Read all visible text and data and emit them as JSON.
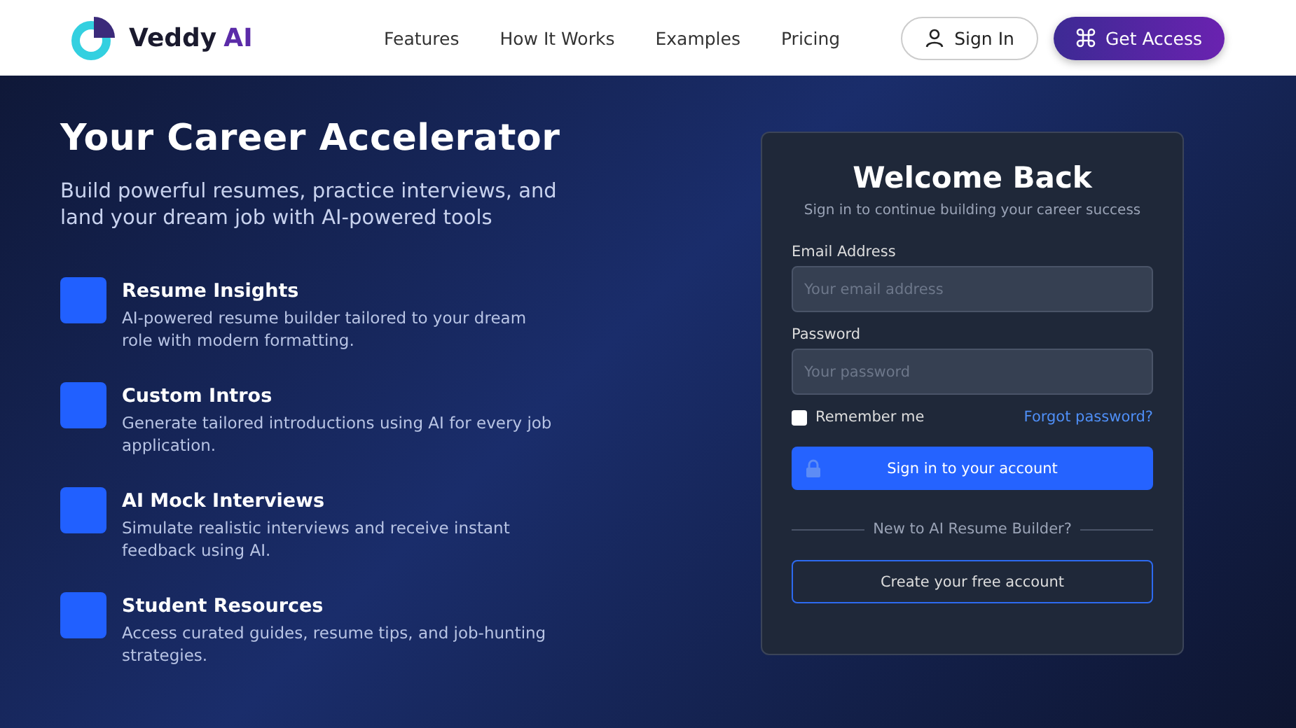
{
  "header": {
    "logo": {
      "name": "Veddy",
      "accent": "AI"
    },
    "nav": [
      {
        "label": "Features"
      },
      {
        "label": "How It Works"
      },
      {
        "label": "Examples"
      },
      {
        "label": "Pricing"
      }
    ],
    "sign_in": "Sign In",
    "get_access": "Get Access"
  },
  "hero": {
    "title": "Your Career Accelerator",
    "subtitle": "Build powerful resumes, practice interviews, and land your dream job with AI-powered tools",
    "features": [
      {
        "title": "Resume Insights",
        "text": "AI-powered resume builder tailored to your dream role with modern formatting."
      },
      {
        "title": "Custom Intros",
        "text": "Generate tailored introductions using AI for every job application."
      },
      {
        "title": "AI Mock Interviews",
        "text": "Simulate realistic interviews and receive instant feedback using AI."
      },
      {
        "title": "Student Resources",
        "text": "Access curated guides, resume tips, and job-hunting strategies."
      }
    ]
  },
  "login": {
    "title": "Welcome Back",
    "subtitle": "Sign in to continue building your career success",
    "fields": [
      {
        "label": "Email Address",
        "placeholder": "Your email address"
      },
      {
        "label": "Password",
        "placeholder": "Your password"
      }
    ],
    "remember": {
      "label": "Remember me",
      "checked": false
    },
    "forgot": "Forgot password?",
    "submit": "Sign in to your account",
    "divider": "New to AI Resume Builder?",
    "create": "Create your free account"
  }
}
